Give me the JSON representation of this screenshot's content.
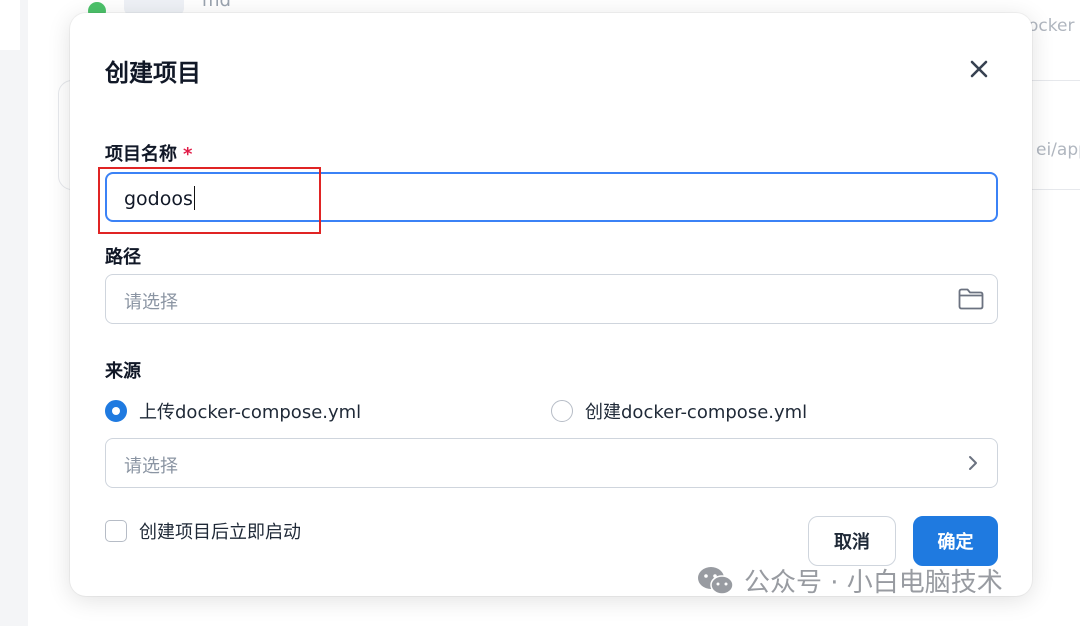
{
  "background": {
    "item_name": "md",
    "partial_text_1": "ocker",
    "partial_text_2": "ei/app"
  },
  "dialog": {
    "title": "创建项目",
    "close_icon": "close-icon",
    "project_name": {
      "label": "项目名称",
      "required_mark": "*",
      "value": "godoos"
    },
    "path": {
      "label": "路径",
      "placeholder": "请选择",
      "icon": "folder-icon"
    },
    "source": {
      "label": "来源",
      "options": [
        {
          "label": "上传docker-compose.yml",
          "selected": true
        },
        {
          "label": "创建docker-compose.yml",
          "selected": false
        }
      ],
      "select_placeholder": "请选择",
      "select_icon": "chevron-right-icon"
    },
    "start_after_create": {
      "label": "创建项目后立即启动",
      "checked": false
    },
    "buttons": {
      "cancel": "取消",
      "confirm": "确定"
    }
  },
  "watermark": {
    "text": "公众号 · 小白电脑技术",
    "icon": "wechat-icon"
  },
  "colors": {
    "primary": "#1f7ae0",
    "focus_border": "#3b82f6",
    "annotation_red": "#e02424",
    "required": "#e11d48"
  }
}
